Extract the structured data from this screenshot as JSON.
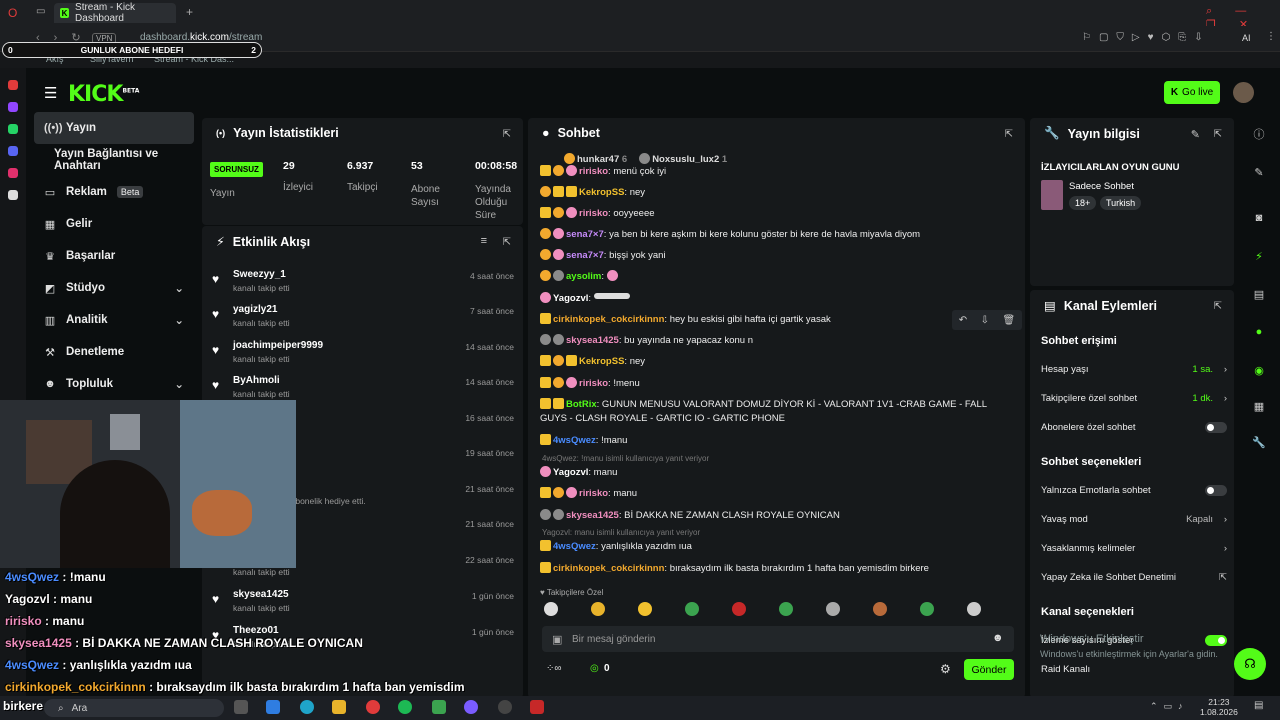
{
  "browser": {
    "tab_title": "Stream - Kick Dashboard",
    "url_prefix": "dashboard.",
    "url_domain": "kick.com",
    "url_path": "/stream",
    "vpn": "VPN",
    "ai_label": "AI",
    "bookmarks": [
      "Akış",
      "SillyTavern",
      "Stream - Kick Das..."
    ]
  },
  "goal": {
    "left": "0",
    "label": "GUNLUK ABONE HEDEFI",
    "right": "2"
  },
  "brand": {
    "logo": "KICK",
    "beta": "BETA",
    "go_live": "Go live"
  },
  "nav": [
    {
      "label": "Yayın",
      "icon": "broadcast-icon",
      "active": true
    },
    {
      "label": "Yayın Bağlantısı ve Anahtarı"
    },
    {
      "label": "Reklam",
      "badge": "Beta"
    },
    {
      "label": "Gelir"
    },
    {
      "label": "Başarılar"
    },
    {
      "label": "Stüdyo",
      "chev": true
    },
    {
      "label": "Analitik",
      "chev": true
    },
    {
      "label": "Denetleme"
    },
    {
      "label": "Topluluk",
      "chev": true
    }
  ],
  "stats": {
    "title": "Yayın İstatistikleri",
    "status": "SORUNSUZ",
    "status_label": "Yayın",
    "items": [
      {
        "value": "29",
        "label": "İzleyici"
      },
      {
        "value": "6.937",
        "label": "Takipçi"
      },
      {
        "value": "53",
        "label": "Abone Sayısı"
      },
      {
        "value": "00:08:58",
        "label": "Yayında Olduğu Süre"
      }
    ]
  },
  "activity": {
    "title": "Etkinlik Akışı",
    "items": [
      {
        "name": "Sweezyy_1",
        "sub": "kanalı takip etti",
        "time": "4 saat önce"
      },
      {
        "name": "yagizly21",
        "sub": "kanalı takip etti",
        "time": "7 saat önce"
      },
      {
        "name": "joachimpeiper9999",
        "sub": "kanalı takip etti",
        "time": "14 saat önce"
      },
      {
        "name": "ByAhmoli",
        "sub": "kanalı takip etti",
        "time": "14 saat önce"
      },
      {
        "name": "ilayanyarag",
        "sub": "",
        "time": "16 saat önce"
      },
      {
        "name": "",
        "sub": "",
        "time": "19 saat önce"
      },
      {
        "name": "2",
        "sub": "imli kullanıcıya abonelik hediye etti.",
        "time": "21 saat önce"
      },
      {
        "name": "",
        "sub": "",
        "time": "21 saat önce"
      },
      {
        "name": "",
        "sub": "kanalı takip etti",
        "time": "22 saat önce"
      },
      {
        "name": "skysea1425",
        "sub": "kanalı takip etti",
        "time": "1 gün önce"
      },
      {
        "name": "Theezo01",
        "sub": "kanalı takip etti",
        "time": "1 gün önce"
      }
    ]
  },
  "chat": {
    "title": "Sohbet",
    "top_users": [
      {
        "name": "hunkar47",
        "n": "6"
      },
      {
        "name": "Noxsuslu_lux2",
        "n": "1"
      }
    ],
    "messages": [
      {
        "user": "ririsko",
        "color": "#f08fbf",
        "text": "menü çok iyi"
      },
      {
        "user": "KekropSS",
        "color": "#f2c12e",
        "text": "ney"
      },
      {
        "user": "ririsko",
        "color": "#f08fbf",
        "text": "ooyyeeee"
      },
      {
        "user": "sena7×7",
        "color": "#c58af9",
        "text": "ya ben bi kere aşkım bi kere kolunu göster bi kere de havla miyavla diyom"
      },
      {
        "user": "sena7×7",
        "color": "#c58af9",
        "text": "bişşi yok yani"
      },
      {
        "user": "aysolim",
        "color": "#53fc18",
        "text": ""
      },
      {
        "user": "Yagozvl",
        "color": "#ffffff",
        "text": ""
      },
      {
        "user": "cirkinkopek_cokcirkinnn",
        "color": "#f2a92e",
        "text": "hey bu eskisi gibi hafta içi gartik yasak"
      },
      {
        "user": "skysea1425",
        "color": "#f08fbf",
        "text": "bu yayında ne yapacaz konu n"
      },
      {
        "user": "KekropSS",
        "color": "#f2c12e",
        "text": "ney"
      },
      {
        "user": "ririsko",
        "color": "#f08fbf",
        "text": "!menu"
      },
      {
        "user": "BotRix",
        "color": "#53fc18",
        "text": "GUNUN MENUSU VALORANT DOMUZ DİYOR Kİ - VALORANT 1V1 -CRAB GAME - FALL GUYS - CLASH ROYALE - GARTIC IO - GARTIC PHONE"
      },
      {
        "user": "4wsQwez",
        "color": "#4a8cff",
        "text": "!manu"
      },
      {
        "user": "Yagozvl",
        "color": "#ffffff",
        "text": "manu",
        "reply": "4wsQwez: !manu isimli kullanıcıya yanıt veriyor"
      },
      {
        "user": "ririsko",
        "color": "#f08fbf",
        "text": "manu"
      },
      {
        "user": "skysea1425",
        "color": "#f08fbf",
        "text": "Bİ DAKKA NE ZAMAN CLASH ROYALE OYNICAN"
      },
      {
        "user": "4wsQwez",
        "color": "#4a8cff",
        "text": "yanlışlıkla yazıdm ıua",
        "reply": "Yagozvl: manu isimli kullanıcıya yanıt veriyor"
      },
      {
        "user": "cirkinkopek_cokcirkinnn",
        "color": "#f2a92e",
        "text": "bıraksaydım ilk basta bırakırdım 1 hafta ban yemisdim birkere"
      }
    ],
    "followers_only": "Takipçilere Özel",
    "input_placeholder": "Bir mesaj gönderin",
    "send": "Gönder",
    "points": "0"
  },
  "info": {
    "title": "Yayın bilgisi",
    "stream_title": "İZLAYICILARLAN OYUN GUNU",
    "category": "Sadece Sohbet",
    "tags": [
      "18+",
      "Turkish"
    ]
  },
  "actions": {
    "title": "Kanal Eylemleri",
    "chat_access": "Sohbet erişimi",
    "rows": [
      {
        "label": "Hesap yaşı",
        "value": "1 sa."
      },
      {
        "label": "Takipçilere özel sohbet",
        "value": "1 dk."
      },
      {
        "label": "Abonelere özel sohbet"
      }
    ],
    "chat_options": "Sohbet seçenekleri",
    "rows2": [
      {
        "label": "Yalnızca Emotlarla sohbet"
      },
      {
        "label": "Yavaş mod",
        "value": "Kapalı"
      },
      {
        "label": "Yasaklanmış kelimeler"
      },
      {
        "label": "Yapay Zeka ile Sohbet Denetimi"
      }
    ],
    "channel_options": "Kanal seçenekleri",
    "rows3": [
      {
        "label": "İzleme sayısını göster"
      },
      {
        "label": "Raid Kanalı"
      }
    ]
  },
  "windows": {
    "line1": "Windows'u Etkinleştir",
    "line2": "Windows'u etkinleştirmek için Ayarlar'a gidin."
  },
  "overlay": [
    {
      "user": "4wsQwez",
      "color": "#4a8cff",
      "text": " : !manu"
    },
    {
      "user": "Yagozvl",
      "color": "#ffffff",
      "text": " : manu"
    },
    {
      "user": "ririsko",
      "color": "#f08fbf",
      "text": " : manu"
    },
    {
      "user": "skysea1425",
      "color": "#f08fbf",
      "text": " : Bİ DAKKA NE ZAMAN CLASH ROYALE OYNICAN"
    },
    {
      "user": "4wsQwez",
      "color": "#4a8cff",
      "text": " : yanlışlıkla yazıdm ıua"
    },
    {
      "user": "cirkinkopek_cokcirkinnn",
      "color": "#f2a92e",
      "text": " : bıraksaydım ilk basta bırakırdım 1 hafta ban yemisdim"
    }
  ],
  "taskbar": {
    "search": "Ara",
    "time": "21:23",
    "date": "1.08.2026",
    "overlay_text": "birkere"
  }
}
